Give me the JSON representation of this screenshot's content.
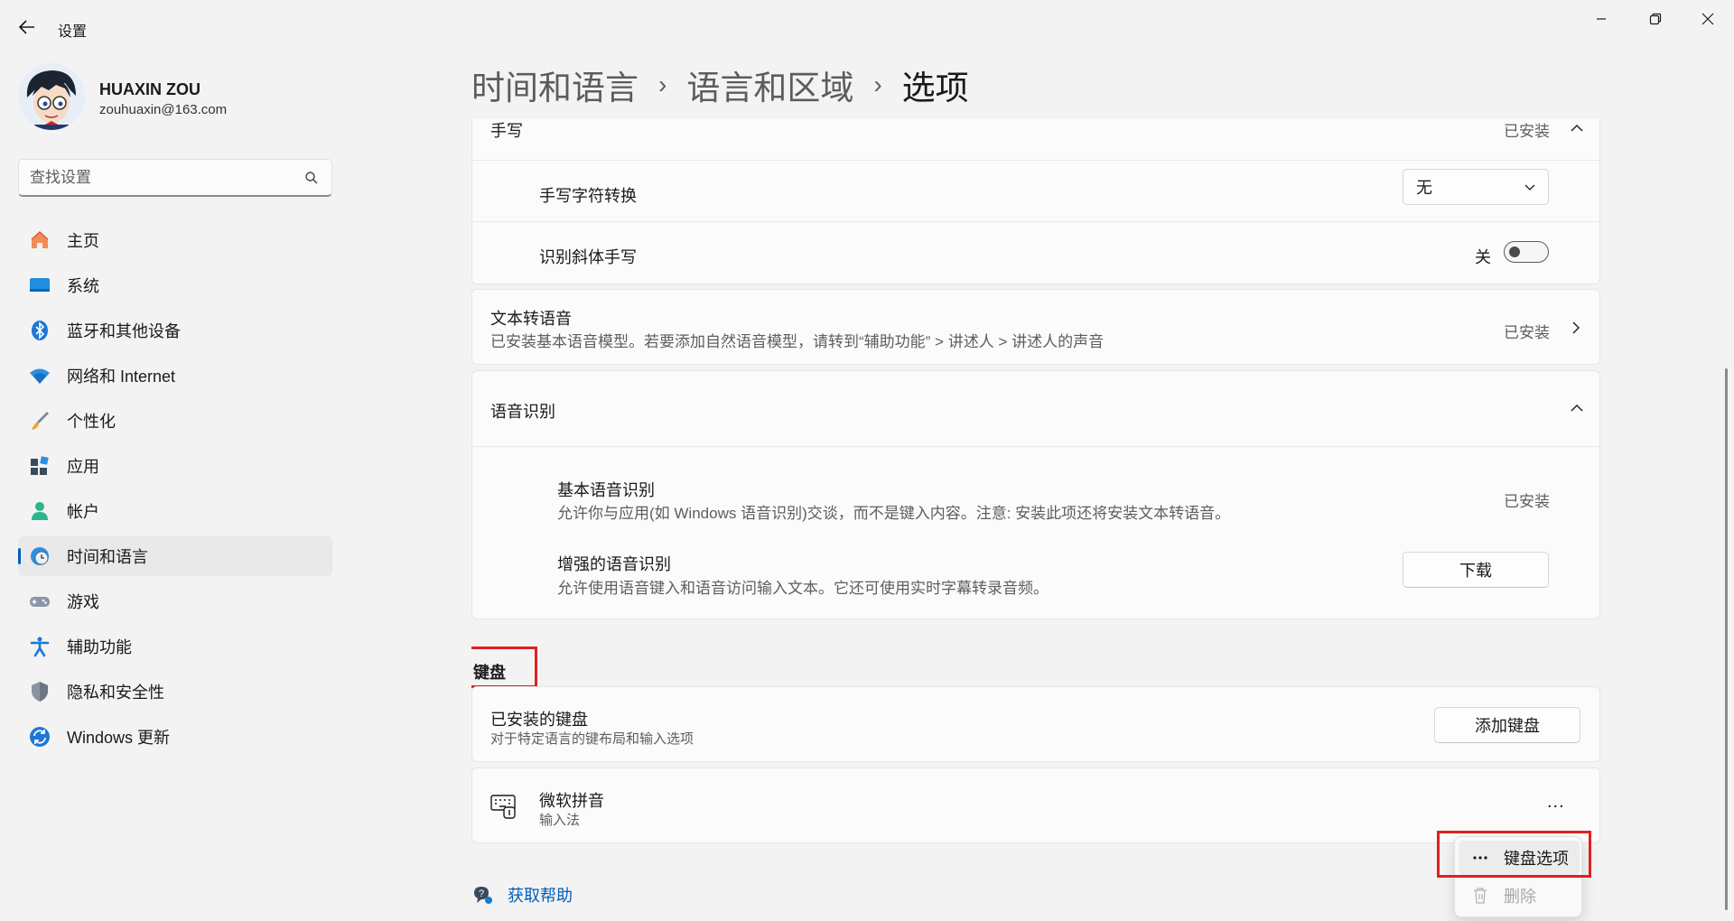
{
  "app": {
    "title": "设置"
  },
  "user": {
    "name": "HUAXIN ZOU",
    "email": "zouhuaxin@163.com"
  },
  "search": {
    "placeholder": "查找设置"
  },
  "nav": [
    {
      "label": "主页",
      "icon": "home-icon"
    },
    {
      "label": "系统",
      "icon": "system-icon"
    },
    {
      "label": "蓝牙和其他设备",
      "icon": "bluetooth-icon"
    },
    {
      "label": "网络和 Internet",
      "icon": "wifi-icon"
    },
    {
      "label": "个性化",
      "icon": "brush-icon"
    },
    {
      "label": "应用",
      "icon": "apps-icon"
    },
    {
      "label": "帐户",
      "icon": "account-icon"
    },
    {
      "label": "时间和语言",
      "icon": "time-language-icon",
      "active": true
    },
    {
      "label": "游戏",
      "icon": "gamepad-icon"
    },
    {
      "label": "辅助功能",
      "icon": "accessibility-icon"
    },
    {
      "label": "隐私和安全性",
      "icon": "shield-icon"
    },
    {
      "label": "Windows 更新",
      "icon": "update-icon"
    }
  ],
  "breadcrumb": {
    "level1": "时间和语言",
    "level2": "语言和区域",
    "current": "选项",
    "separator": "›"
  },
  "handwriting": {
    "title": "手写",
    "status": "已安装",
    "conversion_label": "手写字符转换",
    "conversion_value": "无",
    "italic_label": "识别斜体手写",
    "italic_state": "关"
  },
  "tts": {
    "title": "文本转语音",
    "description": "已安装基本语音模型。若要添加自然语音模型，请转到“辅助功能” > 讲述人 > 讲述人的声音",
    "status": "已安装"
  },
  "speech": {
    "title": "语音识别",
    "basic_title": "基本语音识别",
    "basic_desc": "允许你与应用(如 Windows 语音识别)交谈，而不是键入内容。注意: 安装此项还将安装文本转语音。",
    "basic_status": "已安装",
    "enhanced_title": "增强的语音识别",
    "enhanced_desc": "允许使用语音键入和语音访问输入文本。它还可使用实时字幕转录音频。",
    "download_label": "下载"
  },
  "keyboard": {
    "section_title": "键盘",
    "installed_title": "已安装的键盘",
    "installed_desc": "对于特定语言的键布局和输入选项",
    "add_label": "添加键盘",
    "ime_name": "微软拼音",
    "ime_type": "输入法",
    "more_label": "..."
  },
  "context_menu": {
    "options_label": "键盘选项",
    "delete_label": "删除"
  },
  "help": {
    "label": "获取帮助"
  },
  "colors": {
    "accent": "#005fb8",
    "highlight": "#e02020",
    "background": "#f3f3f3"
  }
}
